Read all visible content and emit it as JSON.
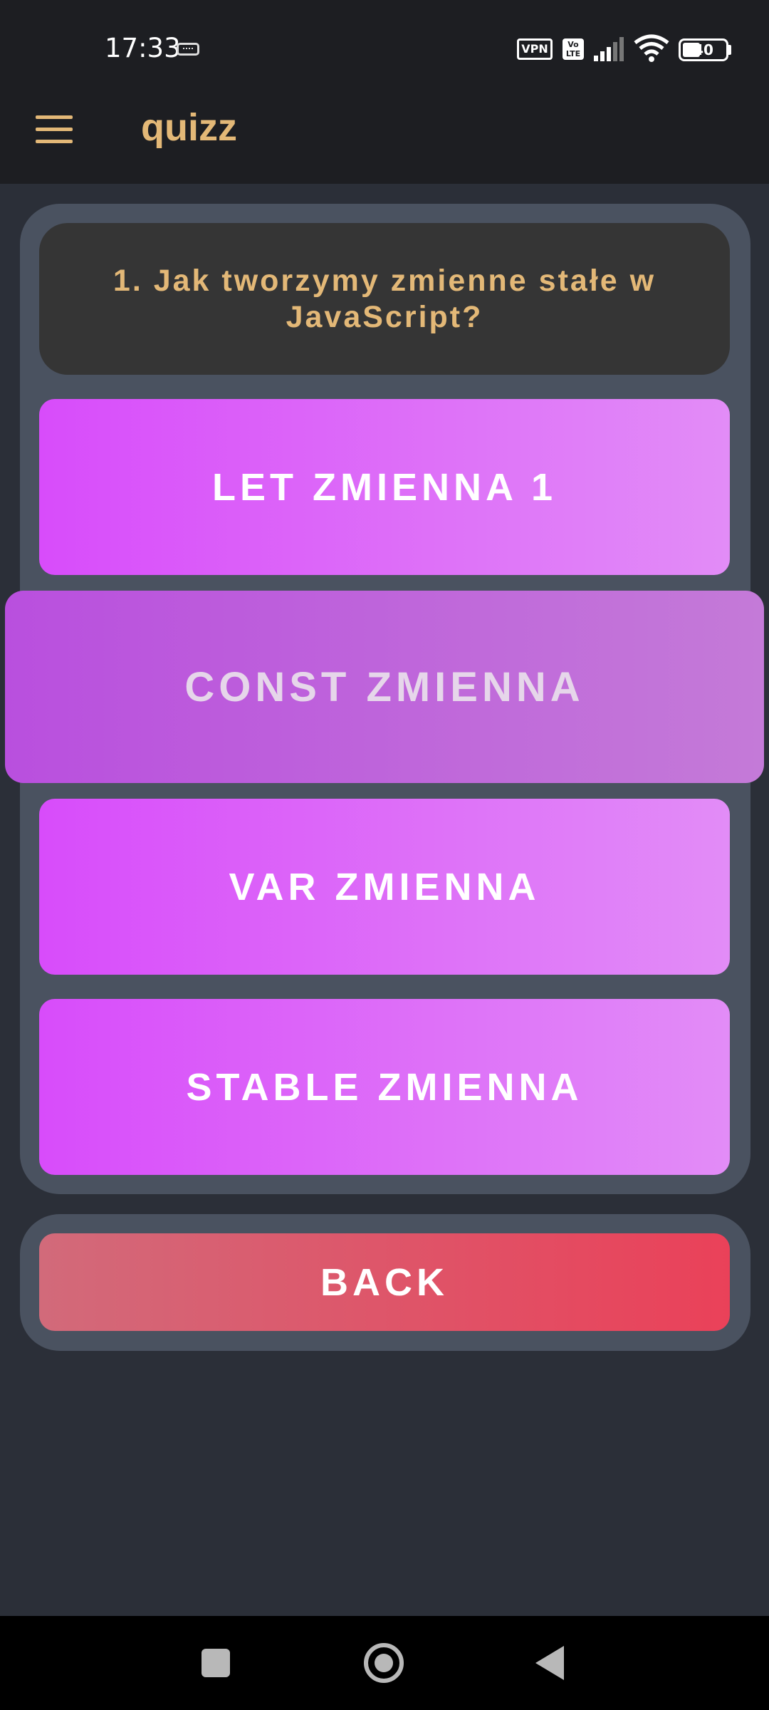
{
  "status_bar": {
    "time": "17:33",
    "vpn_label": "VPN",
    "volte_label": "Vo\nLTE",
    "battery_level": "40",
    "icons": [
      "keyboard-icon",
      "vpn-icon",
      "volte-icon",
      "signal-icon",
      "wifi-icon",
      "battery-icon"
    ]
  },
  "app_bar": {
    "title": "quizz",
    "menu_icon": "hamburger-menu-icon"
  },
  "quiz": {
    "question": "1. Jak tworzymy zmienne stałe w JavaScript?",
    "answers": [
      {
        "label": "LET ZMIENNA 1",
        "pressed": false
      },
      {
        "label": "CONST ZMIENNA",
        "pressed": true
      },
      {
        "label": "VAR ZMIENNA",
        "pressed": false
      },
      {
        "label": "STABLE ZMIENNA",
        "pressed": false
      }
    ]
  },
  "back_button": {
    "label": "BACK"
  },
  "nav_bar": {
    "icons": [
      "recents-icon",
      "home-icon",
      "back-icon"
    ]
  },
  "colors": {
    "background": "#2b2f38",
    "bar": "#1d1e22",
    "card": "#4a5260",
    "question_box": "#353535",
    "accent_text": "#e3b877",
    "answer_gradient_start": "#d84cfa",
    "answer_gradient_end": "#e28cf7",
    "back_gradient_start": "#d26a7a",
    "back_gradient_end": "#ea4159"
  }
}
